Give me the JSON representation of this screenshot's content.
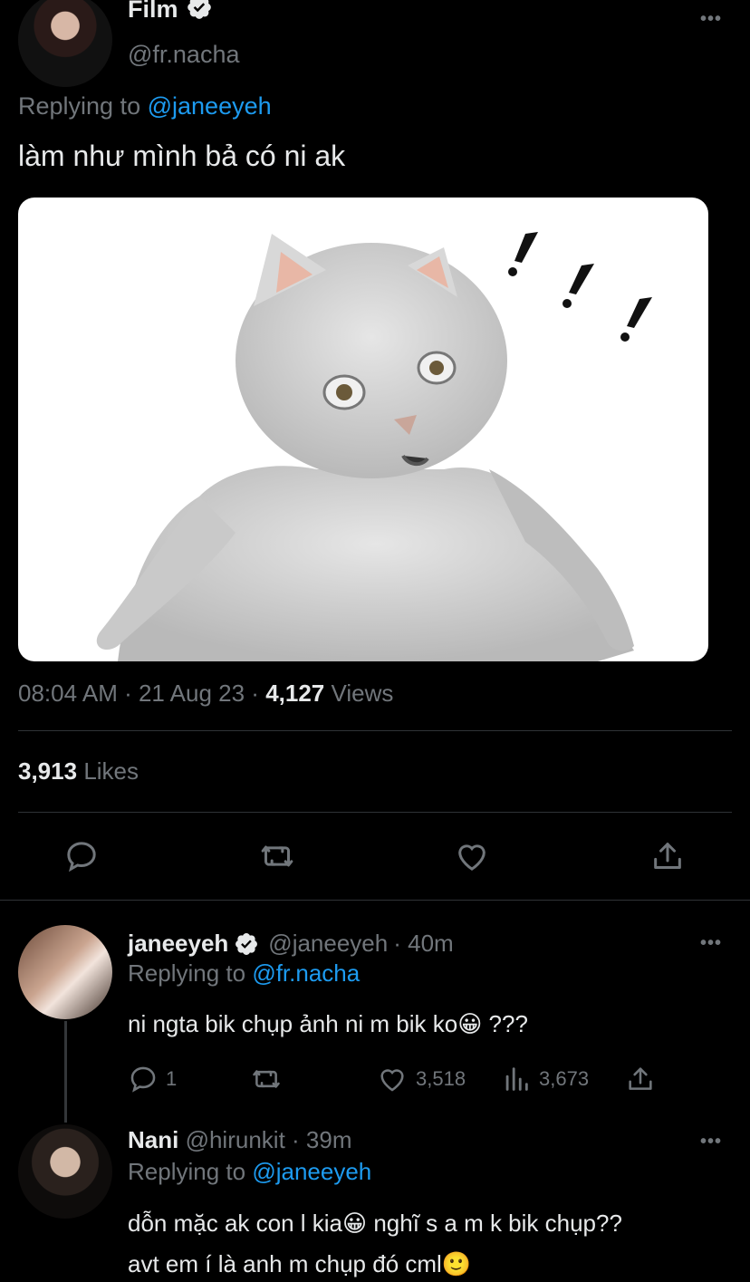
{
  "main_tweet": {
    "display_name": "Film",
    "handle": "@fr.nacha",
    "replying_prefix": "Replying to",
    "replying_handle": "@janeeyeh",
    "text": "làm như mình bả có ni ak",
    "timestamp": "08:04 AM · 21 Aug 23 · ",
    "views_count": "4,127",
    "views_label": "Views",
    "likes_count": "3,913",
    "likes_label": "Likes"
  },
  "reply1": {
    "display_name": "janeeyeh",
    "handle": "@janeeyeh",
    "time": "· 40m",
    "replying_prefix": "Replying to",
    "replying_handle": "@fr.nacha",
    "text": "ni ngta bik chụp ảnh ni m bik ko😀 ???",
    "reply_count": "1",
    "like_count": "3,518",
    "views_count": "3,673"
  },
  "reply2": {
    "display_name": "Nani",
    "handle": "@hirunkit",
    "time": "· 39m",
    "replying_prefix": "Replying to",
    "replying_handle": "@janeeyeh",
    "text_line1": "dỗn mặc ak con l kia😀 nghĩ s a m k bik chụp??",
    "text_line2": "avt em í là anh m chụp đó cml🙂"
  },
  "colors": {
    "background": "#000000",
    "text": "#e7e9ea",
    "muted": "#71767b",
    "link": "#1d9bf0",
    "divider": "#2f3336"
  }
}
